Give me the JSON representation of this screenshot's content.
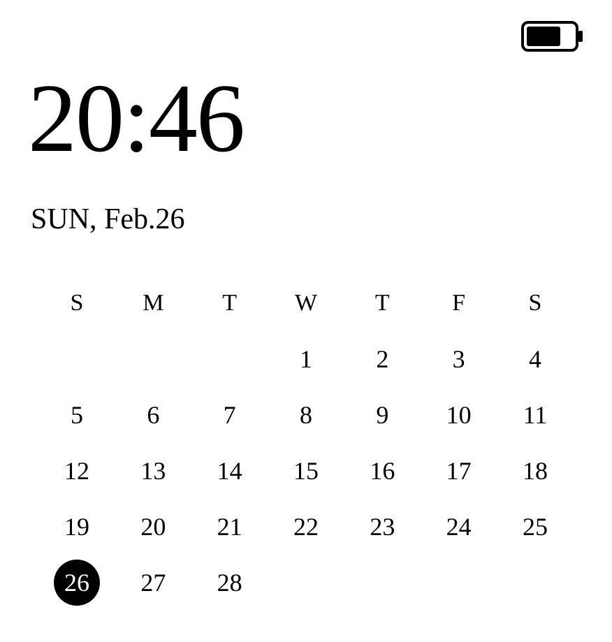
{
  "battery": {
    "level_percent": 70
  },
  "clock": {
    "time": "20:46",
    "date_line": "SUN, Feb.26"
  },
  "calendar": {
    "weekdays": [
      "S",
      "M",
      "T",
      "W",
      "T",
      "F",
      "S"
    ],
    "today": 26,
    "rows": [
      [
        "",
        "",
        "",
        "1",
        "2",
        "3",
        "4"
      ],
      [
        "5",
        "6",
        "7",
        "8",
        "9",
        "10",
        "11"
      ],
      [
        "12",
        "13",
        "14",
        "15",
        "16",
        "17",
        "18"
      ],
      [
        "19",
        "20",
        "21",
        "22",
        "23",
        "24",
        "25"
      ],
      [
        "26",
        "27",
        "28",
        "",
        "",
        "",
        ""
      ]
    ]
  }
}
